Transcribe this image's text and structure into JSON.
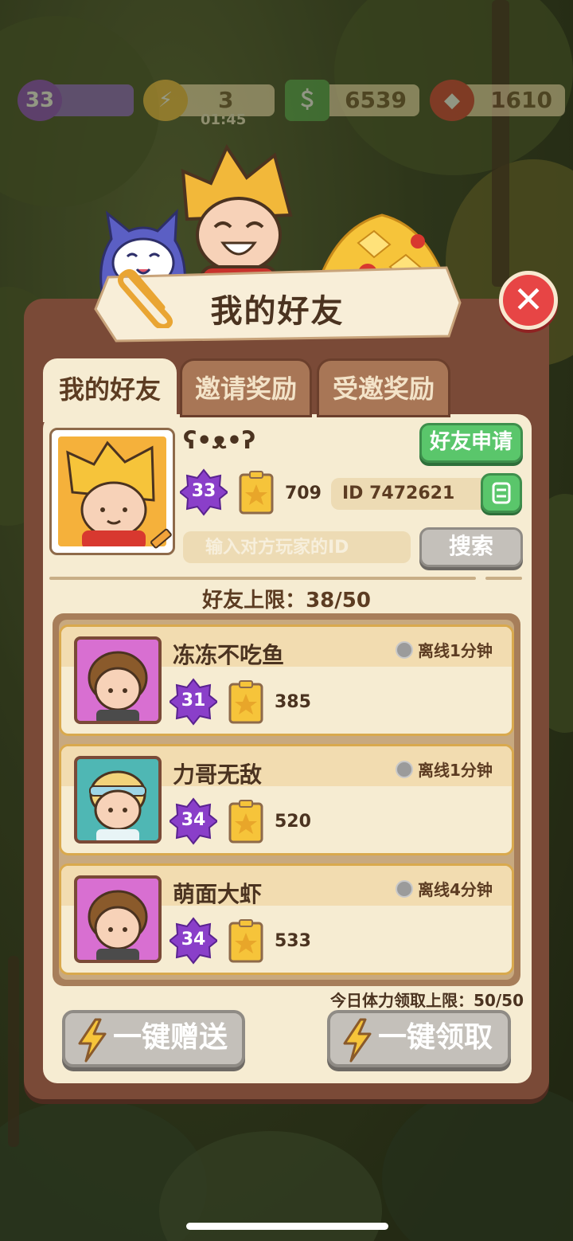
{
  "resources": {
    "level": "33",
    "energy": "3",
    "energy_timer": "01:45",
    "cash": "6539",
    "gems": "1610"
  },
  "dialog": {
    "title": "我的好友",
    "tabs": [
      {
        "label": "我的好友",
        "active": true
      },
      {
        "label": "邀请奖励",
        "active": false
      },
      {
        "label": "受邀奖励",
        "active": false
      }
    ]
  },
  "profile": {
    "name": "ʕ•ᴥ•ʔ",
    "level": "33",
    "stars": "709",
    "id": "ID 7472621",
    "friend_request_label": "好友申请"
  },
  "search": {
    "placeholder": "输入对方玩家的ID",
    "button_label": "搜索"
  },
  "friend_limit": "好友上限：38/50",
  "friends": [
    {
      "name": "冻冻不吃鱼",
      "status": "离线1分钟",
      "level": "31",
      "stars": "385",
      "avatar_bg": "#d86fd1"
    },
    {
      "name": "力哥无敌",
      "status": "离线1分钟",
      "level": "34",
      "stars": "520",
      "avatar_bg": "#4fb7b4"
    },
    {
      "name": "萌面大虾",
      "status": "离线4分钟",
      "level": "34",
      "stars": "533",
      "avatar_bg": "#d86fd1"
    }
  ],
  "stamina_quota": "今日体力领取上限：50/50",
  "actions": {
    "send_all": "一键赠送",
    "claim_all": "一键领取"
  },
  "colors": {
    "panel": "#f6ecd2",
    "frame": "#7a4a37",
    "green_button": "#5ac66b",
    "disabled_button": "#c4c0ba",
    "close": "#e74545",
    "level_badge": "#8a3fc9"
  }
}
